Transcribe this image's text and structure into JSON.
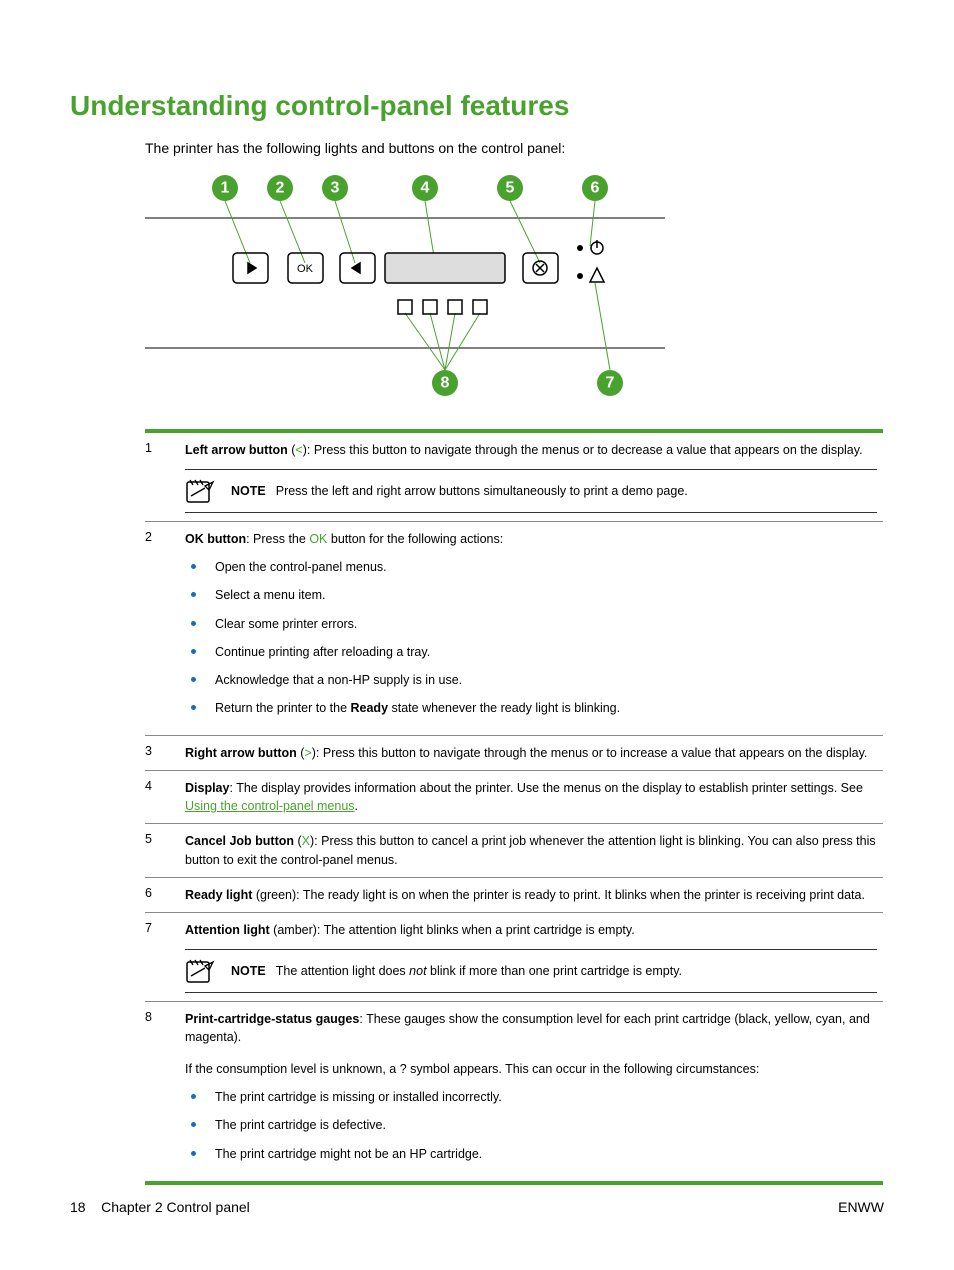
{
  "heading": "Understanding control-panel features",
  "intro": "The printer has the following lights and buttons on the control panel:",
  "callouts": [
    "1",
    "2",
    "3",
    "4",
    "5",
    "6",
    "7",
    "8"
  ],
  "ok_label": "OK",
  "table": {
    "r1": {
      "num": "1",
      "bold": "Left arrow button",
      "sym_open": " (",
      "sym": "<",
      "sym_close": "): ",
      "text": "Press this button to navigate through the menus or to decrease a value that appears on the display.",
      "note_label": "NOTE",
      "note_text": "Press the left and right arrow buttons simultaneously to print a demo page."
    },
    "r2": {
      "num": "2",
      "bold": "OK button",
      "mid1": ": Press the ",
      "ok_green": "OK",
      "mid2": " button for the following actions:",
      "b1": "Open the control-panel menus.",
      "b2": "Select a menu item.",
      "b3": "Clear some printer errors.",
      "b4": "Continue printing after reloading a tray.",
      "b5": "Acknowledge that a non-HP supply is in use.",
      "b6a": "Return the printer to the ",
      "b6bold": "Ready",
      "b6b": " state whenever the ready light is blinking."
    },
    "r3": {
      "num": "3",
      "bold": "Right arrow button",
      "sym_open": " (",
      "sym": ">",
      "sym_close": "): ",
      "text": "Press this button to navigate through the menus or to increase a value that appears on the display."
    },
    "r4": {
      "num": "4",
      "bold": "Display",
      "text": ": The display provides information about the printer. Use the menus on the display to establish printer settings. See ",
      "link": "Using the control-panel menus",
      "tail": "."
    },
    "r5": {
      "num": "5",
      "bold": "Cancel Job button",
      "sym_open": " (",
      "sym": "X",
      "sym_close": "): ",
      "text": "Press this button to cancel a print job whenever the attention light is blinking. You can also press this button to exit the control-panel menus."
    },
    "r6": {
      "num": "6",
      "bold": "Ready light",
      "text": " (green): The ready light is on when the printer is ready to print. It blinks when the printer is receiving print data."
    },
    "r7": {
      "num": "7",
      "bold": "Attention light",
      "text": " (amber): The attention light blinks when a print cartridge is empty.",
      "note_label": "NOTE",
      "note_a": "The attention light does ",
      "note_ital": "not",
      "note_b": " blink if more than one print cartridge is empty."
    },
    "r8": {
      "num": "8",
      "bold": "Print-cartridge-status gauges",
      "text": ": These gauges show the consumption level for each print cartridge (black, yellow, cyan, and magenta).",
      "p2": "If the consumption level is unknown, a ? symbol appears. This can occur in the following circumstances:",
      "b1": "The print cartridge is missing or installed incorrectly.",
      "b2": "The print cartridge is defective.",
      "b3": "The print cartridge might not be an HP cartridge."
    }
  },
  "footer": {
    "page_num": "18",
    "chapter": "Chapter 2   Control panel",
    "right": "ENWW"
  }
}
